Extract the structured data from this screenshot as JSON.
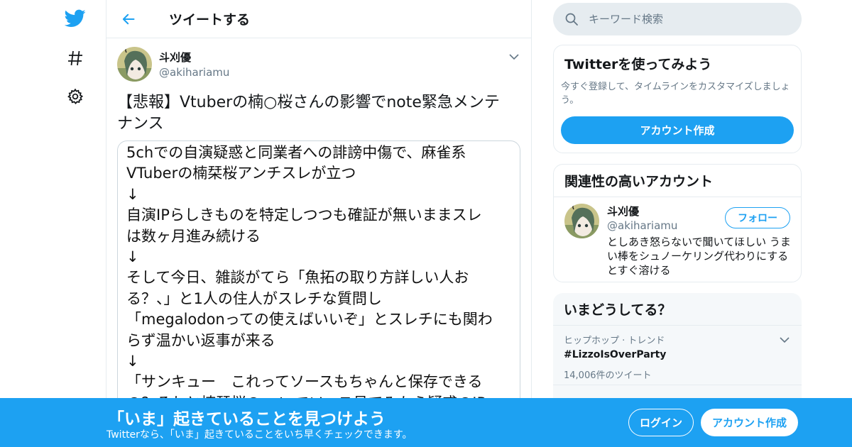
{
  "colors": {
    "accent": "#1da1f2",
    "text_primary": "#14171a",
    "text_secondary": "#657786",
    "border": "#e6ecf0"
  },
  "nav": {
    "logo_icon": "twitter-bird-icon",
    "items": [
      {
        "icon": "hashtag-icon"
      },
      {
        "icon": "gear-icon"
      }
    ]
  },
  "header": {
    "back_icon": "arrow-left-icon",
    "title": "ツイートする"
  },
  "tweet": {
    "author_name": "斗刈優",
    "author_handle": "@akihariamu",
    "text": "【悲報】Vtuberの楠○桜さんの影響でnote緊急メンテナンス",
    "image_lines": [
      "5chでの自演疑惑と同業者への誹謗中傷で、麻雀系",
      "VTuberの楠栞桜アンチスレが立つ",
      "↓",
      "自演IPらしきものを特定しつつも確証が無いままスレ",
      "は数ヶ月進み続ける",
      "↓",
      "そして今日、雑談がてら「魚拓の取り方詳しい人お",
      "る？、」と1人の住人がスレチな質問し",
      "「megalodonっての使えばいいぞ」とスレチにも関わ",
      "らず温かい返事が来る",
      "↓",
      "「サンキュー　これってソースもちゃんと保存できる",
      "の？それと楠栞桜のnoteでソース見てみたら疑惑のIP"
    ]
  },
  "search": {
    "placeholder": "キーワード検索"
  },
  "signup_card": {
    "title": "Twitterを使ってみよう",
    "description": "今すぐ登録して、タイムラインをカスタマイズしましょう。",
    "button": "アカウント作成"
  },
  "related": {
    "title": "関連性の高いアカウント",
    "name": "斗刈優",
    "handle": "@akihariamu",
    "bio": "としあき怒らないで聞いてほしい うまい棒をシュノーケリング代わりにするとすぐ溶ける",
    "follow_button": "フォロー"
  },
  "trends": {
    "title": "いまどうしてる？",
    "items": [
      {
        "context": "ヒップホップ · トレンド",
        "name": "#LizzoIsOverParty",
        "count": "14,006件のツイート"
      }
    ]
  },
  "bottom_bar": {
    "title": "「いま」起きていることを見つけよう",
    "subtitle": "Twitterなら、「いま」起きていることをいち早くチェックできます。",
    "login": "ログイン",
    "signup": "アカウント作成"
  }
}
